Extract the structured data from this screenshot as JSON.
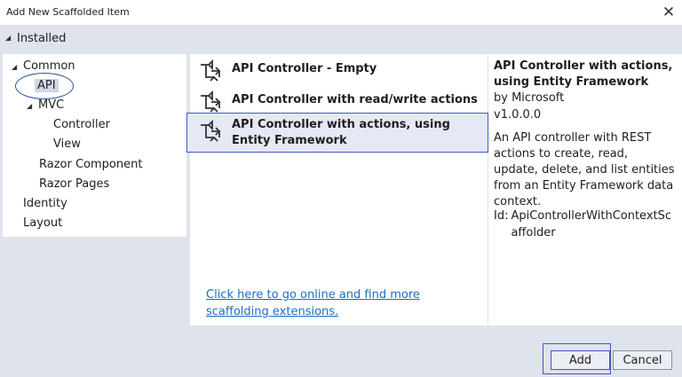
{
  "window": {
    "title": "Add New Scaffolded Item",
    "close_icon": "close-icon"
  },
  "installed": {
    "toggle": "◢",
    "label": "Installed"
  },
  "tree": {
    "common": {
      "toggle": "◢",
      "label": "Common"
    },
    "api": {
      "label": "API"
    },
    "mvc": {
      "toggle": "◢",
      "label": "MVC"
    },
    "controller": {
      "label": "Controller"
    },
    "view": {
      "label": "View"
    },
    "razor_component": {
      "label": "Razor Component"
    },
    "razor_pages": {
      "label": "Razor Pages"
    },
    "identity": {
      "label": "Identity"
    },
    "layout": {
      "label": "Layout"
    }
  },
  "templates": {
    "items": [
      {
        "label": "API Controller - Empty"
      },
      {
        "label": "API Controller with read/write actions"
      },
      {
        "label": "API Controller with actions, using Entity Framework"
      }
    ],
    "online_link": "Click here to go online and find more scaffolding extensions."
  },
  "details": {
    "title": "API Controller with actions, using Entity Framework",
    "author": "by Microsoft",
    "version": "v1.0.0.0",
    "description": "An API controller with REST actions to create, read, update, delete, and list entities from an Entity Framework data context.",
    "id_label": "Id:",
    "id_value": "ApiControllerWithContextScaffolder"
  },
  "footer": {
    "add_label": "Add",
    "cancel_label": "Cancel"
  },
  "colors": {
    "accent": "#3c58c4",
    "link": "#1a6ec7",
    "selection_bg": "#e5e9f6",
    "dialog_bg": "#dfe3ec"
  }
}
